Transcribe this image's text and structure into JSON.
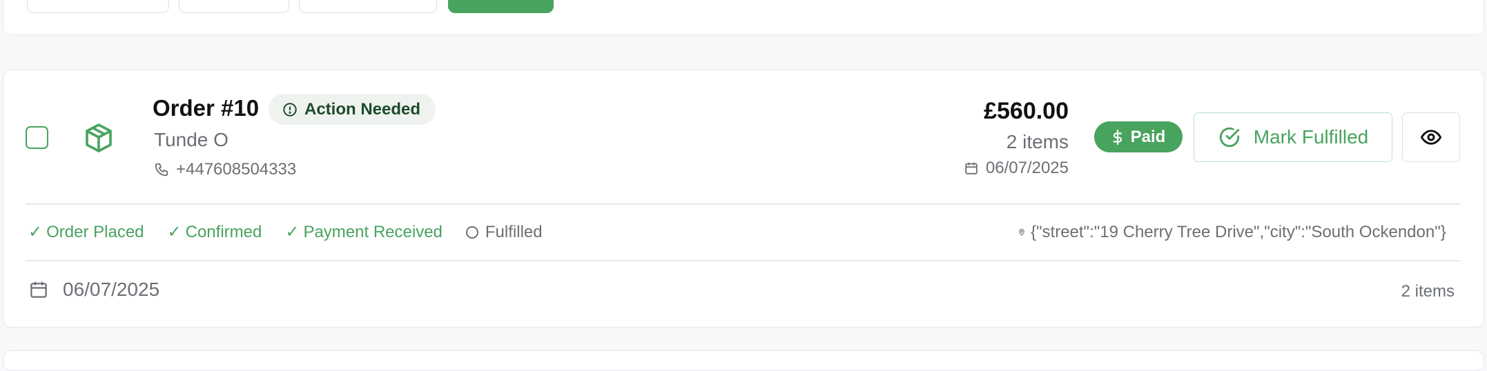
{
  "order": {
    "title": "Order #10",
    "status_badge": "Action Needed",
    "customer_name": "Tunde O",
    "phone": "+447608504333",
    "amount": "£560.00",
    "item_count": "2 items",
    "date": "06/07/2025",
    "payment_status": "Paid",
    "mark_fulfilled_label": "Mark Fulfilled"
  },
  "progress": {
    "steps": [
      {
        "label": "Order Placed",
        "done": true
      },
      {
        "label": "Confirmed",
        "done": true
      },
      {
        "label": "Payment Received",
        "done": true
      },
      {
        "label": "Fulfilled",
        "done": false
      }
    ]
  },
  "address": "{\"street\":\"19 Cherry Tree Drive\",\"city\":\"South Ockendon\"}",
  "footer": {
    "date": "06/07/2025",
    "item_count": "2 items"
  },
  "colors": {
    "accent": "#48a35e",
    "badge_bg": "#eef3ef",
    "muted_text": "#6b6f74"
  },
  "icons": [
    "package-icon",
    "alert-circle-icon",
    "phone-icon",
    "calendar-icon",
    "dollar-icon",
    "check-circle-icon",
    "eye-icon",
    "map-pin-icon"
  ]
}
